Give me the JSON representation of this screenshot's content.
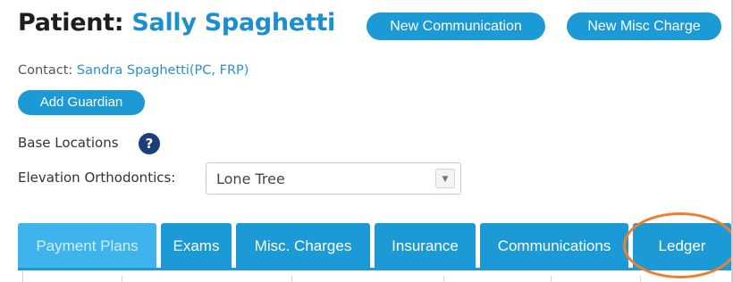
{
  "patient": {
    "label": "Patient:",
    "name": "Sally Spaghetti"
  },
  "header_buttons": {
    "new_communication": "New Communication",
    "new_misc_charge": "New Misc Charge"
  },
  "contact": {
    "label": "Contact:",
    "value": "Sandra Spaghetti(PC, FRP)"
  },
  "add_guardian": "Add Guardian",
  "base_locations": {
    "label": "Base Locations",
    "help_glyph": "?"
  },
  "location_select": {
    "label": "Elevation Orthodontics:",
    "selected": "Lone Tree",
    "arrow_glyph": "▼"
  },
  "tabs": [
    {
      "label": "Payment Plans",
      "active": true
    },
    {
      "label": "Exams",
      "active": false
    },
    {
      "label": "Misc. Charges",
      "active": false
    },
    {
      "label": "Insurance",
      "active": false
    },
    {
      "label": "Communications",
      "active": false
    },
    {
      "label": "Ledger",
      "active": false,
      "annotated": true
    }
  ],
  "colors": {
    "brand_blue": "#1b9ad6",
    "active_tab": "#3fb4ec",
    "link_blue": "#2a8fd0",
    "help_icon": "#1d3e78",
    "annotation_orange": "#ef7f2f"
  }
}
